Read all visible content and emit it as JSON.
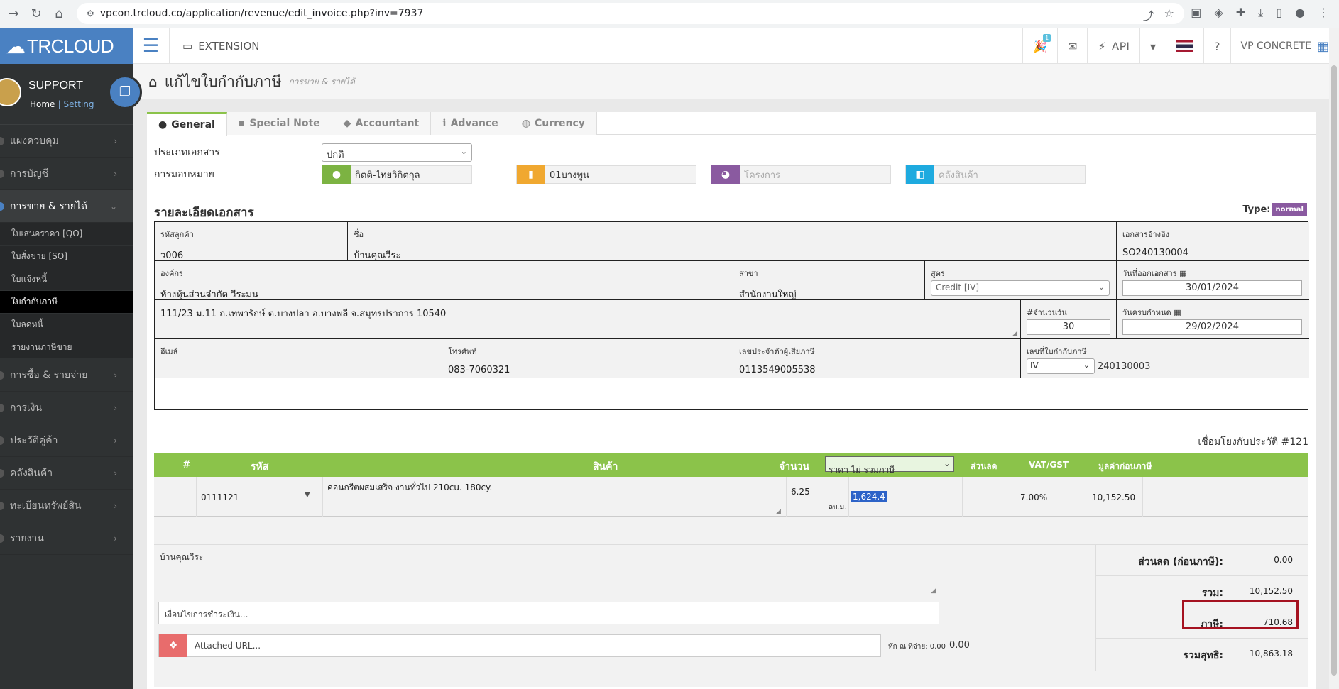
{
  "browser": {
    "url": "vpcon.trcloud.co/application/revenue/edit_invoice.php?inv=7937"
  },
  "sidebar": {
    "brand": "TRCLOUD",
    "user": "SUPPORT",
    "home": "Home",
    "sep": "|",
    "setting": "Setting",
    "menu": [
      {
        "label": "แผงควบคุม"
      },
      {
        "label": "การบัญชี"
      },
      {
        "label": "การขาย & รายได้"
      },
      {
        "label": "การซื้อ & รายจ่าย"
      },
      {
        "label": "การเงิน"
      },
      {
        "label": "ประวัติคู่ค้า"
      },
      {
        "label": "คลังสินค้า"
      },
      {
        "label": "ทะเบียนทรัพย์สิน"
      },
      {
        "label": "รายงาน"
      }
    ],
    "submenu": [
      {
        "label": "ใบเสนอราคา [QO]"
      },
      {
        "label": "ใบสั่งขาย [SO]"
      },
      {
        "label": "ใบแจ้งหนี้"
      },
      {
        "label": "ใบกำกับภาษี"
      },
      {
        "label": "ใบลดหนี้"
      },
      {
        "label": "รายงานภาษีขาย"
      }
    ]
  },
  "topbar": {
    "extension": "EXTENSION",
    "api": "API",
    "company": "VP CONCRETE",
    "notif_count": "1"
  },
  "page": {
    "title": "แก้ไขใบกำกับภาษี",
    "subtitle": "การขาย & รายได้"
  },
  "tabs": [
    {
      "label": "General"
    },
    {
      "label": "Special Note"
    },
    {
      "label": "Accountant"
    },
    {
      "label": "Advance"
    },
    {
      "label": "Currency"
    }
  ],
  "form": {
    "doc_type_label": "ประเภทเอกสาร",
    "doc_type_value": "ปกติ",
    "assign_label": "การมอบหมาย",
    "assign_person": "กิตติ-ไทยวิกิตกุล",
    "assign_branch": "01บางพูน",
    "assign_project": "โครงการ",
    "assign_warehouse": "คลังสินค้า",
    "section_title": "รายละเอียดเอกสาร",
    "type_label": "Type:",
    "type_value": "normal"
  },
  "details": {
    "cust_code_label": "รหัสลูกค้า",
    "cust_code": "ว006",
    "name_label": "ชื่อ",
    "name": "บ้านคุณวีระ",
    "ref_label": "เอกสารอ้างอิง",
    "ref": "SO240130004",
    "org_label": "องค์กร",
    "org": "ห้างหุ้นส่วนจำกัด วีระมน",
    "branch_label": "สาขา",
    "branch": "สำนักงานใหญ่",
    "formula_label": "สูตร",
    "formula": "Credit [IV]",
    "issue_label": "วันที่ออกเอกสาร",
    "issue": "30/01/2024",
    "address": "111/23 ม.11 ถ.เทพารักษ์ ต.บางปลา อ.บางพลี จ.สมุทรปราการ 10540",
    "days_label": "#จำนวนวัน",
    "days": "30",
    "due_label": "วันครบกำหนด",
    "due": "29/02/2024",
    "email_label": "อีเมล์",
    "email": "",
    "phone_label": "โทรศัพท์",
    "phone": "083-7060321",
    "taxid_label": "เลขประจำตัวผู้เสียภาษี",
    "taxid": "0113549005538",
    "invno_label": "เลขที่ใบกำกับภาษี",
    "inv_prefix": "IV",
    "invno": "240130003"
  },
  "history": "เชื่อมโยงกับประวัติ #121",
  "table": {
    "headers": {
      "num": "#",
      "code": "รหัส",
      "product": "สินค้า",
      "qty": "จำนวน",
      "price_mode": "ราคา ไม่ รวมภาษี",
      "discount": "ส่วนลด",
      "vat": "VAT/GST",
      "amount": "มูลค่าก่อนภาษี"
    },
    "rows": [
      {
        "code": "0111121",
        "desc": "คอนกรีตผสมเสร็จ งานทั่วไป 210cu. 180cy.",
        "qty": "6.25",
        "unit": "ลบ.ม.",
        "price": "1,624.4",
        "vat": "7.00%",
        "amount": "10,152.50"
      }
    ]
  },
  "footer": {
    "note": "บ้านคุณวีระ",
    "payment_placeholder": "เงื่อนไขการชำระเงิน...",
    "attach_placeholder": "Attached URL...",
    "wht_label": "หัก ณ ที่จ่าย: 0.00",
    "wht_value": "0.00",
    "discount_label": "ส่วนลด (ก่อนภาษี):",
    "discount": "0.00",
    "subtotal_label": "รวม:",
    "subtotal": "10,152.50",
    "tax_label": "ภาษี:",
    "tax": "710.68",
    "net_label": "รวมสุทธิ:",
    "net": "10,863.18"
  }
}
